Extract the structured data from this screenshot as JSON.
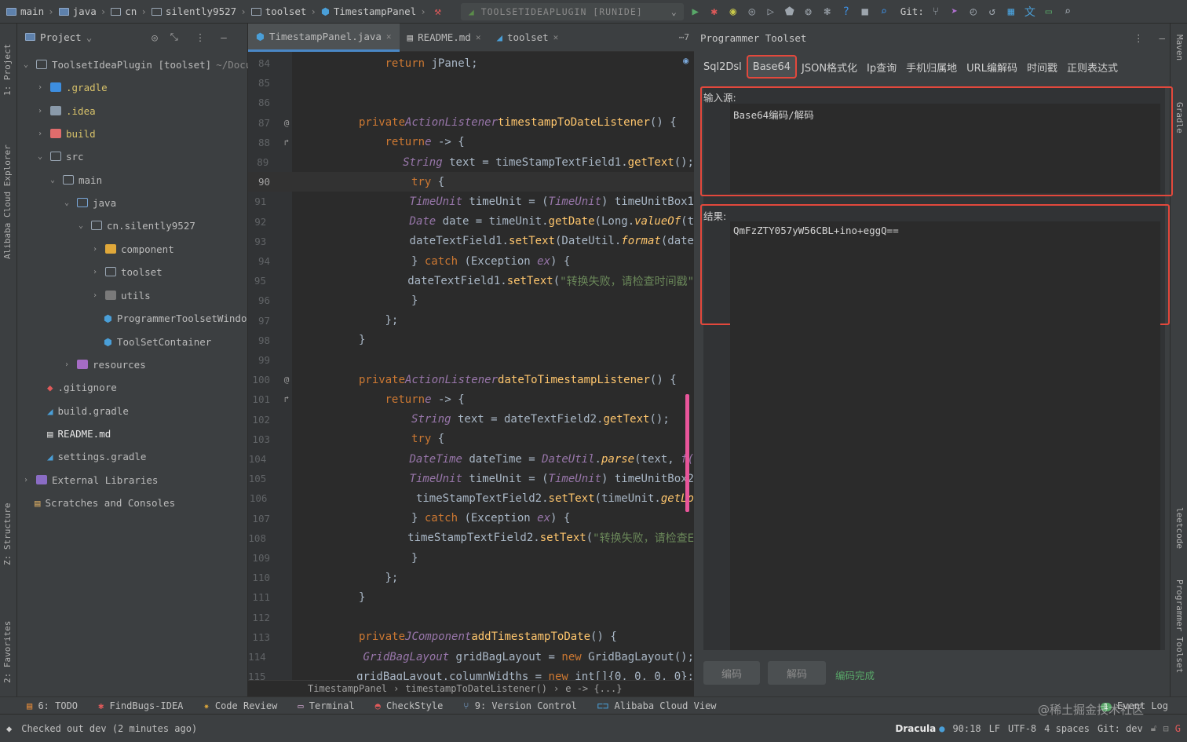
{
  "breadcrumbs": [
    "main",
    "java",
    "cn",
    "silently9527",
    "toolset",
    "TimestampPanel"
  ],
  "run_config": "TOOLSETIDEAPLUGIN [RUNIDE]",
  "git_label": "Git:",
  "left_strip": [
    "1: Project",
    "Alibaba Cloud Explorer",
    "Z: Structure",
    "2: Favorites"
  ],
  "right_strip": [
    "Maven",
    "Gradle",
    "leetcode",
    "Programmer Toolset"
  ],
  "project": {
    "title": "Project",
    "root_name": "ToolsetIdeaPlugin [toolset]",
    "root_path": "~/Docu",
    "items": [
      {
        "label": "ToolsetIdeaPlugin [toolset]",
        "depth": 0
      },
      {
        "label": ".gradle",
        "depth": 1
      },
      {
        "label": ".idea",
        "depth": 1
      },
      {
        "label": "build",
        "depth": 1
      },
      {
        "label": "src",
        "depth": 1
      },
      {
        "label": "main",
        "depth": 2
      },
      {
        "label": "java",
        "depth": 3
      },
      {
        "label": "cn.silently9527",
        "depth": 4
      },
      {
        "label": "component",
        "depth": 5
      },
      {
        "label": "toolset",
        "depth": 5
      },
      {
        "label": "utils",
        "depth": 5
      },
      {
        "label": "ProgrammerToolsetWindo",
        "depth": 5
      },
      {
        "label": "ToolSetContainer",
        "depth": 5
      },
      {
        "label": "resources",
        "depth": 3
      },
      {
        "label": ".gitignore",
        "depth": 1
      },
      {
        "label": "build.gradle",
        "depth": 1
      },
      {
        "label": "README.md",
        "depth": 1
      },
      {
        "label": "settings.gradle",
        "depth": 1
      },
      {
        "label": "External Libraries",
        "depth": 0
      },
      {
        "label": "Scratches and Consoles",
        "depth": 0
      }
    ]
  },
  "editor": {
    "tabs": [
      {
        "label": "TimestampPanel.java",
        "active": true
      },
      {
        "label": "README.md",
        "active": false
      },
      {
        "label": "toolset",
        "active": false
      }
    ],
    "more_tabs": "7",
    "line_numbers": [
      "84",
      "85",
      "86",
      "87",
      "88",
      "89",
      "90",
      "91",
      "92",
      "93",
      "94",
      "95",
      "96",
      "97",
      "98",
      "99",
      "100",
      "101",
      "102",
      "103",
      "104",
      "105",
      "106",
      "107",
      "108",
      "109",
      "110",
      "111",
      "112",
      "113",
      "114",
      "115"
    ],
    "current_line": "90",
    "breadcrumb": [
      "TimestampPanel",
      "timestampToDateListener()",
      "e -> {...}"
    ],
    "code": {
      "l84": {
        "kw": "return",
        "rest": " jPanel;"
      },
      "l87": {
        "mod": "private",
        "type": "ActionListener",
        "fn": "timestampToDateListener",
        "rest": "() {"
      },
      "l88": {
        "kw": "return",
        "param": "e",
        "rest": " -> {"
      },
      "l89": {
        "type": "String",
        "a": " text = timeStampTextField1.",
        "call": "getText",
        "b": "();"
      },
      "l90": {
        "kw": "try",
        "rest": " {"
      },
      "l91": {
        "t1": "TimeUnit",
        "a": " timeUnit = (",
        "t2": "TimeUnit",
        "b": ") timeUnitBox1"
      },
      "l92": {
        "type": "Date",
        "a": " date = timeUnit.",
        "call": "getDate",
        "b": "(Long.",
        "call2": "valueOf",
        "c": "(t"
      },
      "l93": {
        "a": "dateTextField1.",
        "call": "setText",
        "b": "(DateUtil.",
        "call2": "format",
        "c": "(date"
      },
      "l94": {
        "a": "} ",
        "kw": "catch",
        "b": " (Exception ",
        "param": "ex",
        "c": ") {"
      },
      "l95": {
        "a": "dateTextField1.",
        "call": "setText",
        "b": "(",
        "str": "\"转换失败，请检查时间戳\""
      },
      "l96": "}",
      "l97": "};",
      "l98": "}",
      "l100": {
        "mod": "private",
        "type": "ActionListener",
        "fn": "dateToTimestampListener",
        "rest": "() {"
      },
      "l101": {
        "kw": "return",
        "param": "e",
        "rest": " -> {"
      },
      "l102": {
        "type": "String",
        "a": " text = dateTextField2.",
        "call": "getText",
        "b": "();"
      },
      "l103": {
        "kw": "try",
        "rest": " {"
      },
      "l104": {
        "type": "DateTime",
        "a": " dateTime = ",
        "t2": "DateUtil",
        "b": ".",
        "call": "parse",
        "c": "(text, ",
        "d": "f("
      },
      "l105": {
        "t1": "TimeUnit",
        "a": " timeUnit = (",
        "t2": "TimeUnit",
        "b": ") timeUnitBox2"
      },
      "l106": {
        "a": "timeStampTextField2.",
        "call": "setText",
        "b": "(timeUnit.",
        "call2": "getLo"
      },
      "l107": {
        "a": "} ",
        "kw": "catch",
        "b": " (Exception ",
        "param": "ex",
        "c": ") {"
      },
      "l108": {
        "a": "timeStampTextField2.",
        "call": "setText",
        "b": "(",
        "str": "\"转换失败，请检查E"
      },
      "l109": "}",
      "l110": "};",
      "l111": "}",
      "l113": {
        "mod": "private",
        "type": "JComponent",
        "fn": "addTimestampToDate",
        "rest": "() {"
      },
      "l114": {
        "type": "GridBagLayout",
        "a": " gridBagLayout = ",
        "kw": "new",
        "b": " GridBagLayout();"
      },
      "l115": {
        "a": "gridBagLayout.columnWidths = ",
        "kw": "new",
        "b": " int[]{0, 0, 0, 0};"
      }
    }
  },
  "toolset": {
    "title": "Programmer Toolset",
    "tabs": [
      "Sql2Dsl",
      "Base64",
      "JSON格式化",
      "Ip查询",
      "手机归属地",
      "URL编解码",
      "时间戳",
      "正则表达式"
    ],
    "selected_tab": "Base64",
    "input_label": "输入源:",
    "input_value": "Base64编码/解码",
    "result_label": "结果:",
    "result_value": "QmFzZTY057yW56CBL+ino+eggQ==",
    "encode_button": "编码",
    "decode_button": "解码",
    "status_text": "编码完成",
    "accent_color": "#e3483c"
  },
  "bottom_tools": [
    {
      "label": "6: TODO"
    },
    {
      "label": "FindBugs-IDEA"
    },
    {
      "label": "Code Review"
    },
    {
      "label": "Terminal"
    },
    {
      "label": "CheckStyle"
    },
    {
      "label": "9: Version Control"
    },
    {
      "label": "Alibaba Cloud View"
    }
  ],
  "event_log": "Event Log",
  "event_count": "1",
  "status": {
    "message": "Checked out dev (2 minutes ago)",
    "theme": "Dracula",
    "position": "90:18",
    "line_sep": "LF",
    "encoding": "UTF-8",
    "indent": "4 spaces",
    "git_branch": "Git: dev",
    "watermark": "@稀土掘金技术社区"
  }
}
